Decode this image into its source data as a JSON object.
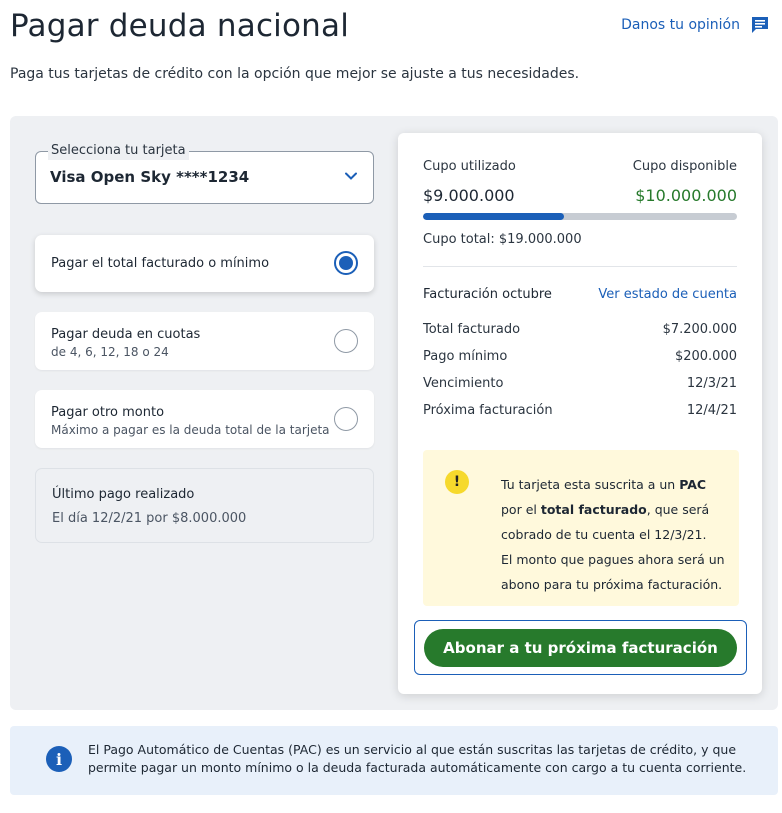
{
  "header": {
    "title": "Pagar deuda nacional",
    "feedback_label": "Danos tu opinión",
    "subtitle": "Paga tus tarjetas de crédito con la opción que mejor se ajuste a tus necesidades."
  },
  "card_select": {
    "legend": "Selecciona tu tarjeta",
    "value": "Visa Open Sky ****1234"
  },
  "options": [
    {
      "title": "Pagar el total facturado o mínimo",
      "subtitle": "",
      "selected": true
    },
    {
      "title": "Pagar deuda en cuotas",
      "subtitle": "de 4, 6, 12, 18 o 24",
      "selected": false
    },
    {
      "title": "Pagar otro monto",
      "subtitle": "Máximo a pagar es la deuda total de la tarjeta",
      "selected": false
    }
  ],
  "last_payment": {
    "title": "Último pago realizado",
    "detail": "El día 12/2/21 por $8.000.000"
  },
  "summary": {
    "used_label": "Cupo utilizado",
    "used_value": "$9.000.000",
    "available_label": "Cupo disponible",
    "available_value": "$10.000.000",
    "usage_fraction": 0.45,
    "total_label": "Cupo total: $19.000.000",
    "billing_label": "Facturación octubre",
    "statement_link": "Ver estado de cuenta",
    "rows": [
      {
        "label": "Total facturado",
        "value": "$7.200.000"
      },
      {
        "label": "Pago mínimo",
        "value": "$200.000"
      },
      {
        "label": "Vencimiento",
        "value": "12/3/21"
      },
      {
        "label": "Próxima facturación",
        "value": "12/4/21"
      }
    ]
  },
  "notice": {
    "icon": "!",
    "line1_pre": "Tu tarjeta esta suscrita a un ",
    "line1_bold": "PAC",
    "line2_pre": "por el ",
    "line2_bold": "total facturado",
    "line2_post": ", que será",
    "line3": "cobrado de tu cuenta el 12/3/21.",
    "line4": "El monto que pagues ahora será un",
    "line5": "abono para tu próxima facturación."
  },
  "cta_label": "Abonar a tu próxima facturación",
  "info_banner": {
    "icon": "i",
    "line1": "El Pago Automático de Cuentas (PAC) es un servicio al que están suscritas las tarjetas de crédito, y que",
    "line2": "permite pagar un monto mínimo o la deuda facturada automáticamente con cargo a tu cuenta corriente."
  },
  "colors": {
    "accent": "#1b5fb8",
    "success": "#277a2c",
    "warning_bg": "#fff9dc",
    "warning_icon": "#f6d92c",
    "available_text": "#277a2c"
  },
  "icons": {
    "feedback": "feedback-icon",
    "chevron": "chevron-down-icon",
    "warning": "warning-icon",
    "info": "info-icon"
  }
}
